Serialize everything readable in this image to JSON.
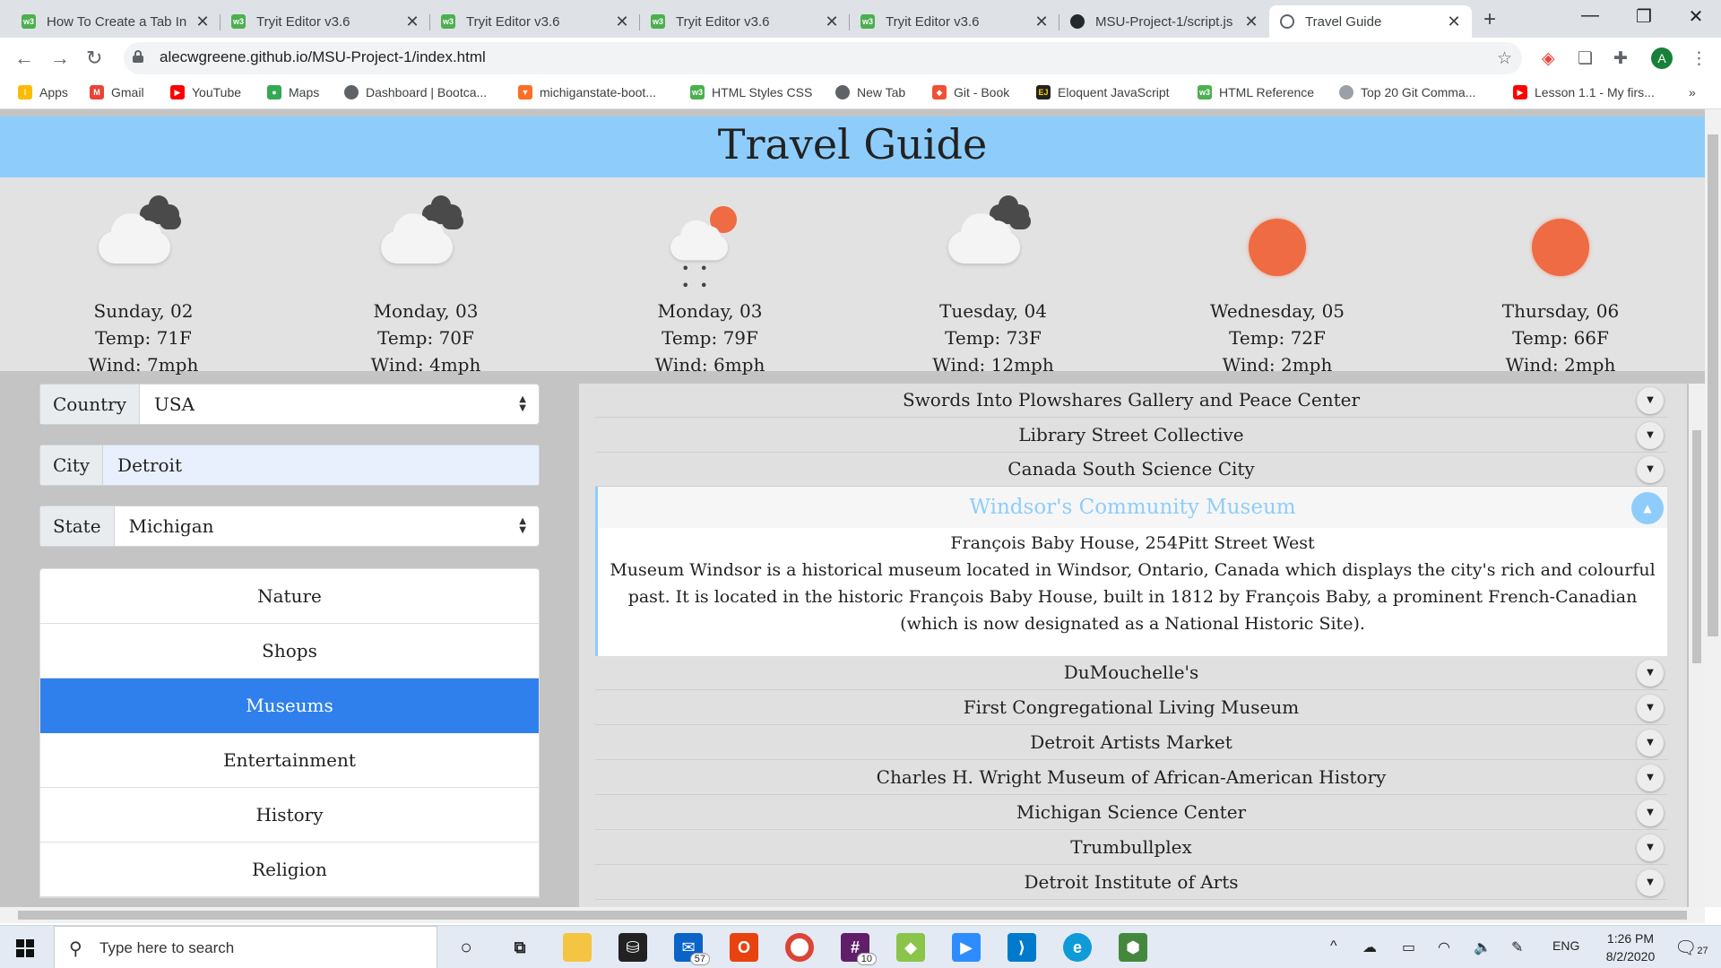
{
  "browser": {
    "tabs": [
      {
        "title": "How To Create a Tab In",
        "icon": "w3-icon",
        "left": 0
      },
      {
        "title": "Tryit Editor v3.6",
        "icon": "w3-icon"
      },
      {
        "title": "Tryit Editor v3.6",
        "icon": "w3-icon"
      },
      {
        "title": "Tryit Editor v3.6",
        "icon": "w3-icon"
      },
      {
        "title": "Tryit Editor v3.6",
        "icon": "w3-icon"
      },
      {
        "title": "MSU-Project-1/script.js",
        "icon": "github-icon"
      },
      {
        "title": "Travel Guide",
        "icon": "globe-icon"
      }
    ],
    "url": "alecwgreene.github.io/MSU-Project-1/index.html",
    "profile_initial": "A",
    "bookmarks": [
      "Apps",
      "Gmail",
      "YouTube",
      "Maps",
      "Dashboard | Bootca...",
      "michiganstate-boot...",
      "HTML Styles CSS",
      "New Tab",
      "Git - Book",
      "Eloquent JavaScript",
      "HTML Reference",
      "Top 20 Git Comma...",
      "Lesson 1.1 - My firs..."
    ],
    "bookmarks_more": "»"
  },
  "page": {
    "title": "Travel Guide",
    "forecast": [
      {
        "date": "Sunday, 02",
        "temp": "Temp: 71F",
        "wind": "Wind: 7mph",
        "icon": "cloudy-icon"
      },
      {
        "date": "Monday, 03",
        "temp": "Temp: 70F",
        "wind": "Wind: 4mph",
        "icon": "cloudy-icon"
      },
      {
        "date": "Monday, 03",
        "temp": "Temp: 79F",
        "wind": "Wind: 6mph",
        "icon": "rain-sun-icon"
      },
      {
        "date": "Tuesday, 04",
        "temp": "Temp: 73F",
        "wind": "Wind: 12mph",
        "icon": "cloudy-icon"
      },
      {
        "date": "Wednesday, 05",
        "temp": "Temp: 72F",
        "wind": "Wind: 2mph",
        "icon": "sun-icon"
      },
      {
        "date": "Thursday, 06",
        "temp": "Temp: 66F",
        "wind": "Wind: 2mph",
        "icon": "sun-icon"
      }
    ],
    "filters": {
      "country_label": "Country",
      "country_value": "USA",
      "city_label": "City",
      "city_value": "Detroit",
      "state_label": "State",
      "state_value": "Michigan"
    },
    "categories": [
      "Nature",
      "Shops",
      "Museums",
      "Entertainment",
      "History",
      "Religion"
    ],
    "active_category": "Museums",
    "places_before": [
      "Swords Into Plowshares Gallery and Peace Center",
      "Library Street Collective",
      "Canada South Science City"
    ],
    "expanded_place": {
      "name": "Windsor's Community Museum",
      "address": "François Baby House, 254Pitt Street West",
      "description": "Museum Windsor is a historical museum located in Windsor, Ontario, Canada which displays the city's rich and colourful past. It is located in the historic François Baby House, built in 1812 by François Baby, a prominent French-Canadian (which is now designated as a National Historic Site)."
    },
    "places_after": [
      "DuMouchelle's",
      "First Congregational Living Museum",
      "Detroit Artists Market",
      "Charles H. Wright Museum of African-American History",
      "Michigan Science Center",
      "Trumbullplex",
      "Detroit Institute of Arts"
    ]
  },
  "taskbar": {
    "search_placeholder": "Type here to search",
    "mail_badge": "57",
    "slack_badge": "10",
    "language": "ENG",
    "time": "1:26 PM",
    "date": "8/2/2020",
    "notifications": "27"
  },
  "colors": {
    "header": "#8ecdfb",
    "active_category": "#2f80ed",
    "sun": "#ee6b43"
  }
}
